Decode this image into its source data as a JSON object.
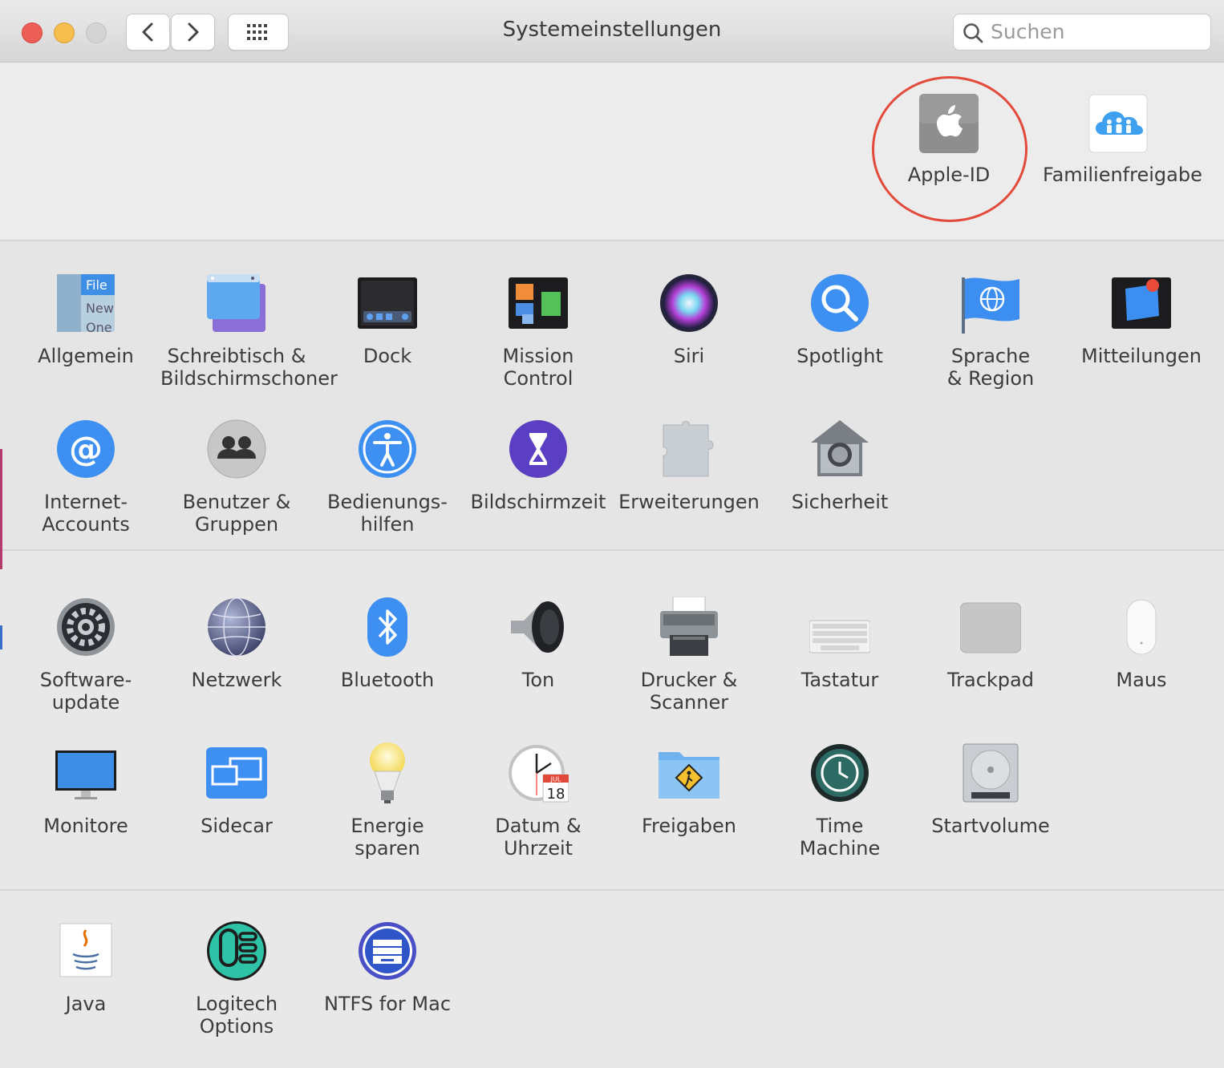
{
  "window": {
    "title": "Systemeinstellungen"
  },
  "search": {
    "placeholder": "Suchen"
  },
  "top": {
    "apple_id": "Apple-ID",
    "family": "Familienfreigabe"
  },
  "row1": [
    "Allgemein",
    "Schreibtisch &\nBildschirmschoner",
    "Dock",
    "Mission\nControl",
    "Siri",
    "Spotlight",
    "Sprache\n& Region",
    "Mitteilungen"
  ],
  "row2": [
    "Internet-\nAccounts",
    "Benutzer &\nGruppen",
    "Bedienungs-\nhilfen",
    "Bildschirmzeit",
    "Erweiterungen",
    "Sicherheit"
  ],
  "row3": [
    "Software-\nupdate",
    "Netzwerk",
    "Bluetooth",
    "Ton",
    "Drucker &\nScanner",
    "Tastatur",
    "Trackpad",
    "Maus"
  ],
  "row4": [
    "Monitore",
    "Sidecar",
    "Energie\nsparen",
    "Datum &\nUhrzeit",
    "Freigaben",
    "Time\nMachine",
    "Startvolume"
  ],
  "row5": [
    "Java",
    "Logitech Options",
    "NTFS for Mac"
  ],
  "clock_icon_text": {
    "month": "JUL",
    "day": "18"
  },
  "allgemein_icon_text": {
    "file": "File",
    "new": "New",
    "one": "One"
  },
  "colors": {
    "close": "#ec5f57",
    "minimize": "#f5be4f",
    "zoom_disabled": "#d0d0d0",
    "highlight": "#e24b3b"
  }
}
